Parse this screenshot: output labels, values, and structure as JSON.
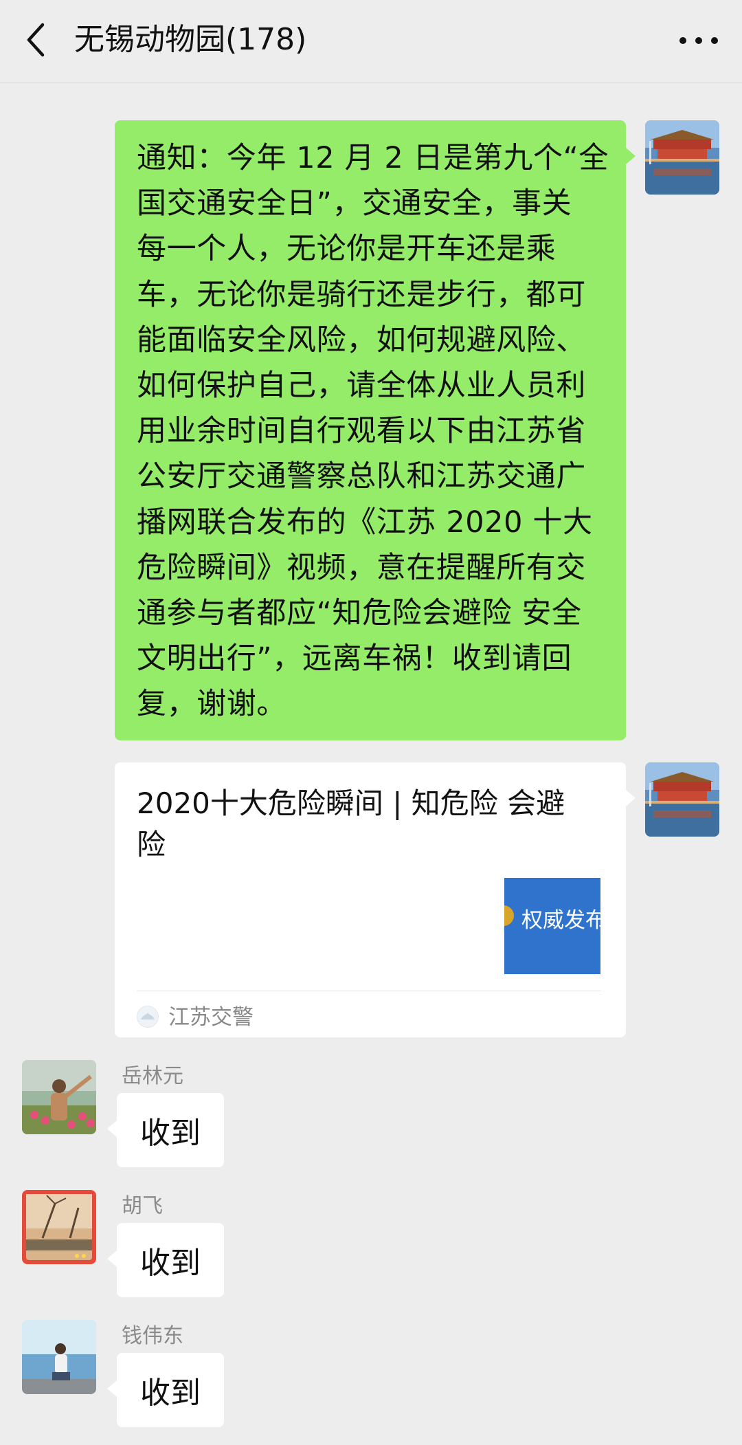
{
  "header": {
    "title": "无锡动物园(178)",
    "back_icon": "chevron-left-icon",
    "more_icon": "more-icon"
  },
  "messages": {
    "notice": {
      "lines": [
        "通知：今年 12 月 2 日是第九个“全",
        "国交通安全日”，交通安全，事关",
        "每一个人，无论你是开车还是乘",
        "车，无论你是骑行还是步行，都可",
        "能面临安全风险，如何规避风险、",
        "如何保护自己，请全体从业人员利",
        "用业余时间自行观看以下由江苏省",
        "公安厅交通警察总队和江苏交通广",
        "播网联合发布的《江苏 2020 十大",
        "危险瞬间》视频，意在提醒所有交",
        "通参与者都应“知危险会避险 安全",
        "文明出行”，远离车祸！收到请回",
        "复，谢谢。"
      ]
    },
    "card": {
      "title_lines": [
        "2020十大危险瞬间 | 知危险 会避",
        "险"
      ],
      "thumbnail_text": "权威发布",
      "source": "江苏交警"
    },
    "replies": [
      {
        "sender": "岳林元",
        "text": "收到"
      },
      {
        "sender": "胡飞",
        "text": "收到"
      },
      {
        "sender": "钱伟东",
        "text": "收到"
      }
    ]
  },
  "colors": {
    "background": "#ededed",
    "self_bubble": "#95ec69",
    "other_bubble": "#ffffff",
    "name_text": "#8a8a8a"
  }
}
